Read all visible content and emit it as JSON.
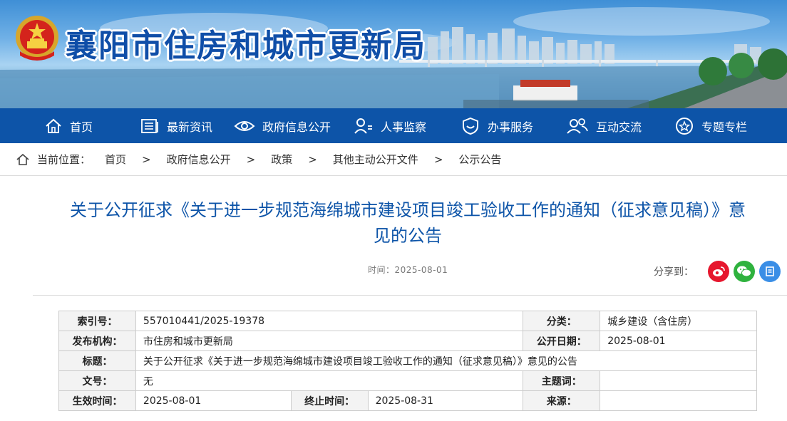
{
  "header": {
    "site_title": "襄阳市住房和城市更新局",
    "emblem_icon": "national-emblem-icon"
  },
  "nav": {
    "items": [
      {
        "label": "首页",
        "icon": "home-icon"
      },
      {
        "label": "最新资讯",
        "icon": "news-icon"
      },
      {
        "label": "政府信息公开",
        "icon": "eye-icon"
      },
      {
        "label": "人事监察",
        "icon": "person-icon"
      },
      {
        "label": "办事服务",
        "icon": "shield-icon"
      },
      {
        "label": "互动交流",
        "icon": "people-icon"
      },
      {
        "label": "专题专栏",
        "icon": "star-icon"
      }
    ]
  },
  "breadcrumb": {
    "prefix": "当前位置：",
    "items": [
      "首页",
      "政府信息公开",
      "政策",
      "其他主动公开文件",
      "公示公告"
    ],
    "separator": ">"
  },
  "article": {
    "title": "关于公开征求《关于进一步规范海绵城市建设项目竣工验收工作的通知（征求意见稿）》意见的公告",
    "time_label": "时间：",
    "time_value": "2025-08-01",
    "share_label": "分享到："
  },
  "info": {
    "index_label": "索引号：",
    "index_value": "557010441/2025-19378",
    "category_label": "分类：",
    "category_value": "城乡建设（含住房）",
    "publisher_label": "发布机构：",
    "publisher_value": "市住房和城市更新局",
    "pubdate_label": "公开日期：",
    "pubdate_value": "2025-08-01",
    "title_label": "标题：",
    "title_value": "关于公开征求《关于进一步规范海绵城市建设项目竣工验收工作的通知（征求意见稿）》意见的公告",
    "docno_label": "文号：",
    "docno_value": "无",
    "keywords_label": "主题词：",
    "keywords_value": "",
    "effective_label": "生效时间：",
    "effective_value": "2025-08-01",
    "end_label": "终止时间：",
    "end_value": "2025-08-31",
    "source_label": "来源：",
    "source_value": ""
  },
  "colors": {
    "nav_bg": "#0d54a8",
    "title_blue": "#0d54a8",
    "weibo": "#e6162d",
    "wechat": "#2fb23e",
    "other_share": "#3a8ee6"
  }
}
